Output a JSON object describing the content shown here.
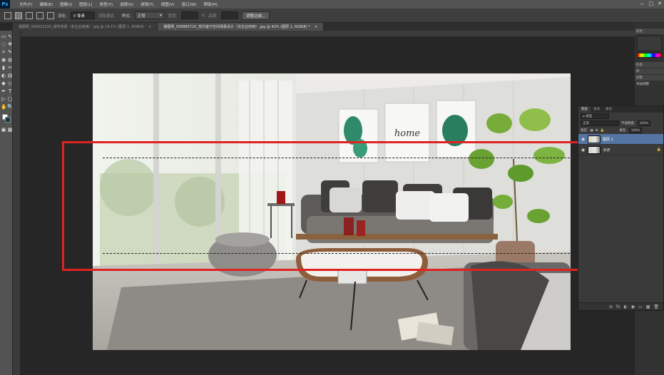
{
  "app": {
    "logo": "Ps",
    "menu": [
      "文件(F)",
      "编辑(E)",
      "图像(I)",
      "图层(L)",
      "类型(Y)",
      "选择(S)",
      "滤镜(T)",
      "视图(V)",
      "窗口(W)",
      "帮助(H)"
    ],
    "window_controls": [
      "—",
      "□",
      "✕"
    ]
  },
  "options": {
    "feather_label": "羽化:",
    "feather_value": "0 像素",
    "antialias_label": "消除锯齿",
    "style_label": "样式:",
    "style_value": "正常",
    "width_label": "宽度:",
    "height_label": "高度:",
    "refine_button": "调整边缘..."
  },
  "tabs": [
    {
      "label": "摄图网_500615120_城市夜景（非企业商用）.jpg @ 19.1% (图层 1, RGB/8)",
      "close": "×",
      "active": false
    },
    {
      "label": "摄图网_500885720_现代客厅空间场景设计（非企业商用）.jpg @ 42% (图层 1, RGB/8) *",
      "close": "×",
      "active": true
    }
  ],
  "tools": [
    "▭",
    "↖",
    "◌",
    "✥",
    "⌗",
    "✎",
    "◉",
    "◍",
    "▮",
    "✂",
    "◐",
    "▤",
    "◆",
    "◇",
    "✒",
    "T",
    "▷",
    "▢",
    "✋",
    "🔍",
    "▣",
    "▦"
  ],
  "dock": {
    "tabs": [
      "颜色",
      "色板",
      "库",
      "调整"
    ],
    "adjust_label": "添加调整"
  },
  "layers_panel": {
    "tabs": [
      "图层",
      "通道",
      "路径"
    ],
    "filter_label": "ρ 类型",
    "blend_mode": "正常",
    "opacity_label": "不透明度:",
    "opacity_value": "100%",
    "lock_label": "锁定:",
    "fill_label": "填充:",
    "fill_value": "100%",
    "layers": [
      {
        "name": "图层 1",
        "selected": true
      },
      {
        "name": "背景",
        "selected": false,
        "locked": true
      }
    ],
    "footer_icons": [
      "⊖",
      "fx",
      "◐",
      "◉",
      "▭",
      "▦",
      "🗑"
    ]
  },
  "canvas": {
    "poster_text": "home"
  },
  "colors": {
    "selection_highlight": "#e02222",
    "layer_selected": "#5575a4"
  }
}
